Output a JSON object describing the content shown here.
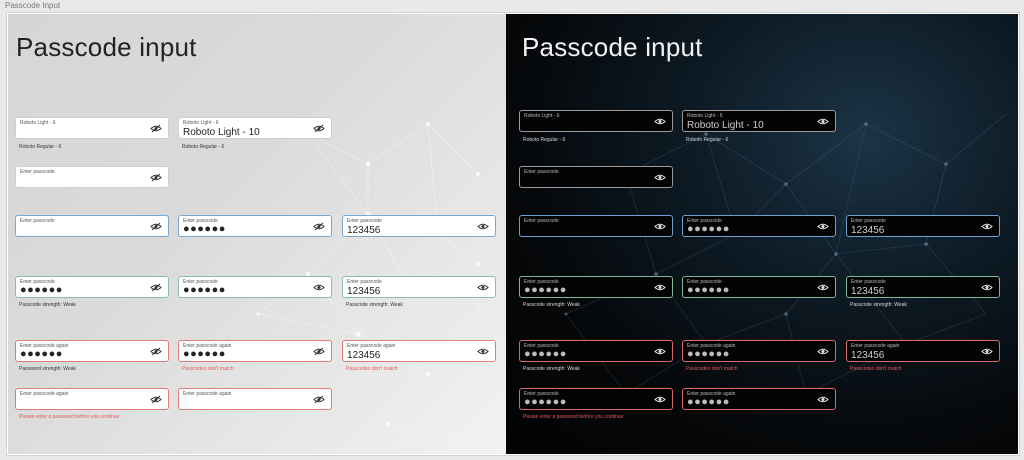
{
  "frame_label": "Passcode Input",
  "light": {
    "title": "Passcode input",
    "row1": [
      {
        "label": "Roboto Light - 6",
        "value": "",
        "note": "Roboto Regular - 6"
      },
      {
        "label": "Roboto Light - 6",
        "value": "Roboto Light - 10",
        "note": "Roboto Regular - 6"
      }
    ],
    "row2": [
      {
        "label": "Enter passcode",
        "value": ""
      }
    ],
    "row3": [
      {
        "label": "Enter passcode",
        "value": ""
      },
      {
        "label": "Enter passcode",
        "value": "●●●●●●"
      },
      {
        "label": "Enter passcode",
        "value": "123456"
      }
    ],
    "row4": [
      {
        "label": "Enter passcode",
        "value": "●●●●●●",
        "note": "Passcode strength: Weak"
      },
      {
        "label": "Enter passcode",
        "value": "●●●●●●"
      },
      {
        "label": "Enter passcode",
        "value": "123456",
        "note": "Passcode strength: Weak"
      }
    ],
    "row5": [
      {
        "label": "Enter passcode again",
        "value": "●●●●●●",
        "note": "Password strength: Weak"
      },
      {
        "label": "Enter passcode again",
        "value": "●●●●●●",
        "note": "Passcodes don't match"
      },
      {
        "label": "Enter passcode again",
        "value": "123456",
        "note": "Passcodes don't match"
      }
    ],
    "row6": [
      {
        "label": "Enter passcode again",
        "value": "",
        "note": "Please enter a password before you continue"
      },
      {
        "label": "Enter passcode again",
        "value": ""
      }
    ]
  },
  "dark": {
    "title": "Passcode input",
    "row1": [
      {
        "label": "Roboto Light - 6",
        "value": "",
        "note": "Roboto Regular - 6"
      },
      {
        "label": "Roboto Light - 6",
        "value": "Roboto Light - 10",
        "note": "Roboto Regular - 6"
      }
    ],
    "row2": [
      {
        "label": "Enter passcode",
        "value": ""
      }
    ],
    "row3": [
      {
        "label": "Enter passcode",
        "value": ""
      },
      {
        "label": "Enter passcode",
        "value": "●●●●●●"
      },
      {
        "label": "Enter passcode",
        "value": "123456"
      }
    ],
    "row4": [
      {
        "label": "Enter passcode",
        "value": "●●●●●●",
        "note": "Passcode strength: Weak"
      },
      {
        "label": "Enter passcode",
        "value": "●●●●●●"
      },
      {
        "label": "Enter passcode",
        "value": "123456",
        "note": "Passcode strength: Weak"
      }
    ],
    "row5": [
      {
        "label": "Enter passcode",
        "value": "●●●●●●",
        "note": "Passcode strength: Weak"
      },
      {
        "label": "Enter passcode again",
        "value": "●●●●●●",
        "note": "Passcodes don't match"
      },
      {
        "label": "Enter passcode again",
        "value": "123456",
        "note": "Passcodes don't match"
      }
    ],
    "row6": [
      {
        "label": "Enter passcode",
        "value": "●●●●●●",
        "note": "Please enter a password before you continue"
      },
      {
        "label": "Enter passcode again",
        "value": "●●●●●●"
      }
    ]
  },
  "icons": {
    "hidden": "eye-slash-icon",
    "visible": "eye-icon"
  },
  "colors": {
    "focus_blue": "#76a8d6",
    "success_green": "#86c2a0",
    "error_red": "#e07a7a",
    "error_text": "#e25a5a"
  }
}
